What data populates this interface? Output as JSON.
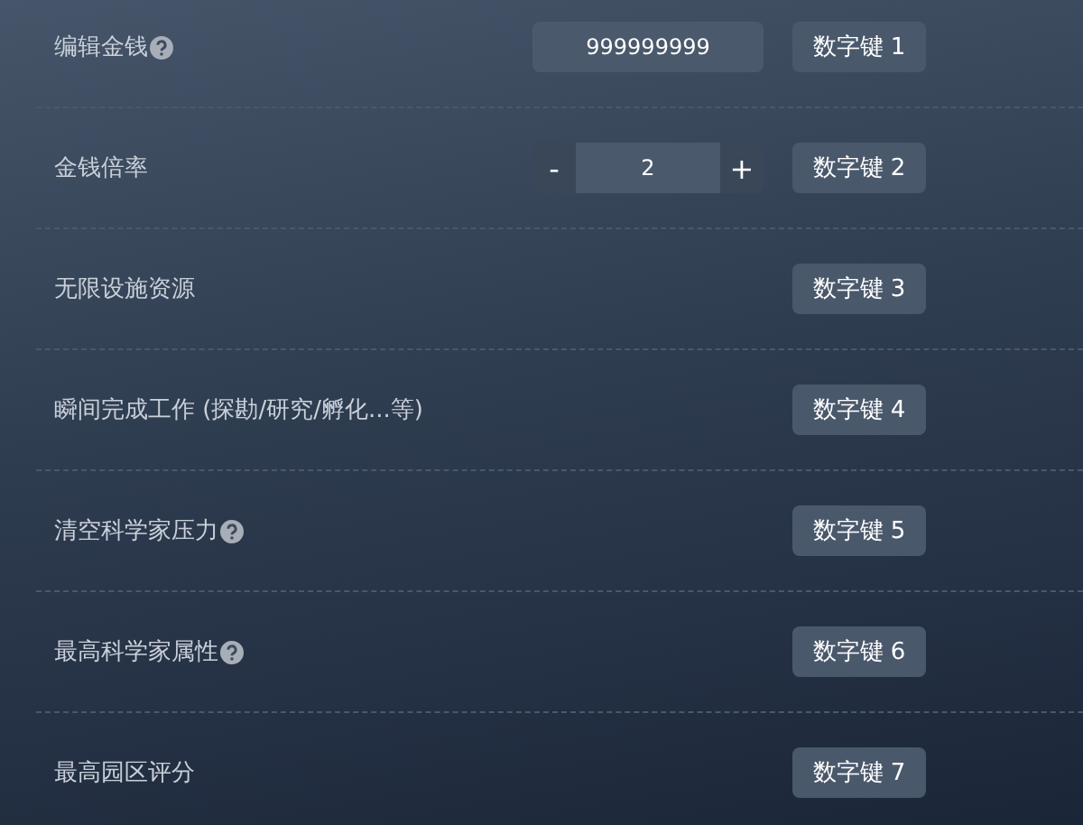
{
  "rows": [
    {
      "label": "编辑金钱",
      "help": true,
      "kind": "input",
      "value": "999999999",
      "hotkey": "数字键 1"
    },
    {
      "label": "金钱倍率",
      "help": false,
      "kind": "stepper",
      "minus": "-",
      "value": "2",
      "plus": "+",
      "hotkey": "数字键 2"
    },
    {
      "label": "无限设施资源",
      "help": false,
      "kind": "none",
      "hotkey": "数字键 3"
    },
    {
      "label": "瞬间完成工作 (探勘/研究/孵化...等)",
      "help": false,
      "kind": "none",
      "hotkey": "数字键 4"
    },
    {
      "label": "清空科学家压力",
      "help": true,
      "kind": "none",
      "hotkey": "数字键 5"
    },
    {
      "label": "最高科学家属性",
      "help": true,
      "kind": "none",
      "hotkey": "数字键 6"
    },
    {
      "label": "最高园区评分",
      "help": false,
      "kind": "none",
      "hotkey": "数字键 7"
    }
  ]
}
